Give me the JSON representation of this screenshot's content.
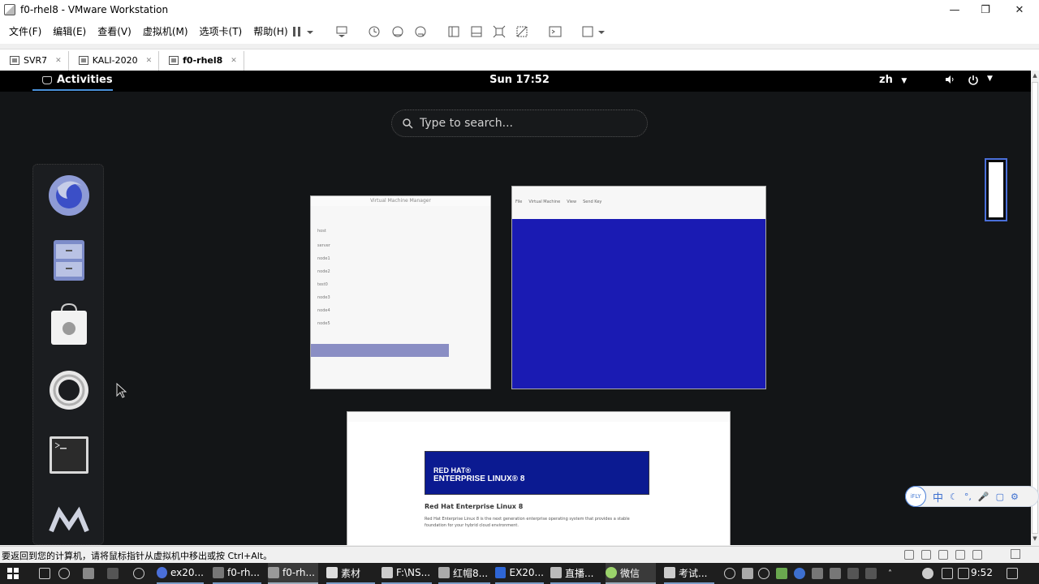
{
  "window": {
    "title": "f0-rhel8 - VMware Workstation",
    "controls": {
      "minimize": "—",
      "restore": "❐",
      "close": "✕"
    }
  },
  "menu": [
    "文件(F)",
    "编辑(E)",
    "查看(V)",
    "虚拟机(M)",
    "选项卡(T)",
    "帮助(H)"
  ],
  "vm_tabs": [
    {
      "label": "SVR7",
      "active": false
    },
    {
      "label": "KALI-2020",
      "active": false
    },
    {
      "label": "f0-rhel8",
      "active": true
    }
  ],
  "guest": {
    "activities_label": "Activities",
    "clock": "Sun 17:52",
    "language": "zh",
    "search_placeholder": "Type to search...",
    "dash_apps": [
      "firefox-icon",
      "files-icon",
      "software-icon",
      "help-icon",
      "terminal-icon",
      "virt-manager-icon"
    ],
    "window_thumbs": {
      "virt_viewer_title": "Virtual Machine Manager",
      "vm_console_menu": [
        "File",
        "Virtual Machine",
        "View",
        "Send Key"
      ],
      "browser_heading": "Red Hat Enterprise Linux 8",
      "browser_text": "Red Hat Enterprise Linux 8 is the next generation enterprise operating system that provides a stable foundation for your hybrid cloud environment.",
      "banner_line1": "RED HAT®",
      "banner_line2": "ENTERPRISE LINUX® 8",
      "vm_list": [
        "host",
        "server",
        "node1",
        "node2",
        "test0",
        "node3",
        "node4",
        "node5"
      ]
    }
  },
  "ime_bar": {
    "badge": "iFLY",
    "mode": "中"
  },
  "status_message": "要返回到您的计算机，请将鼠标指针从虚拟机中移出或按 Ctrl+Alt。",
  "taskbar": {
    "items": [
      "ex20...",
      "f0-rh...",
      "f0-rh...",
      "素材",
      "F:\\NS...",
      "红帽8...",
      "EX20...",
      "直播...",
      "微信",
      "考试..."
    ],
    "time": "9:52"
  }
}
